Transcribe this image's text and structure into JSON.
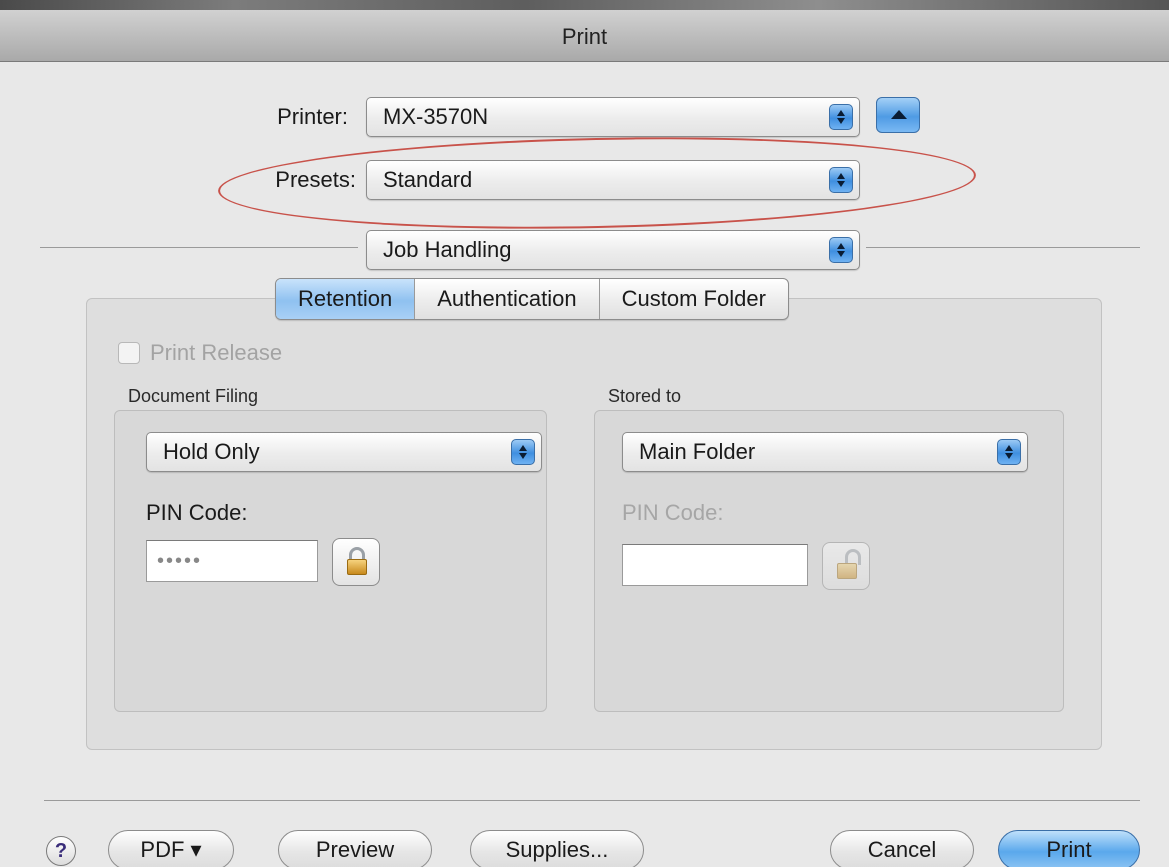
{
  "window": {
    "title": "Print"
  },
  "printer": {
    "label": "Printer:",
    "value": "MX-3570N"
  },
  "presets": {
    "label": "Presets:",
    "value": "Standard"
  },
  "panel": {
    "value": "Job Handling"
  },
  "tabs": [
    {
      "label": "Retention",
      "active": true
    },
    {
      "label": "Authentication",
      "active": false
    },
    {
      "label": "Custom Folder",
      "active": false
    }
  ],
  "print_release": {
    "label": "Print Release",
    "checked": false,
    "enabled": false
  },
  "document_filing": {
    "section_label": "Document Filing",
    "value": "Hold Only",
    "pin_label": "PIN Code:",
    "pin_value": "•••••"
  },
  "stored_to": {
    "section_label": "Stored to",
    "value": "Main Folder",
    "pin_label": "PIN Code:",
    "pin_value": ""
  },
  "buttons": {
    "help": "?",
    "pdf": "PDF ▾",
    "preview": "Preview",
    "supplies": "Supplies...",
    "cancel": "Cancel",
    "print": "Print"
  },
  "colors": {
    "accent_blue": "#5aa8ec",
    "annotation_red": "#c8524a"
  }
}
